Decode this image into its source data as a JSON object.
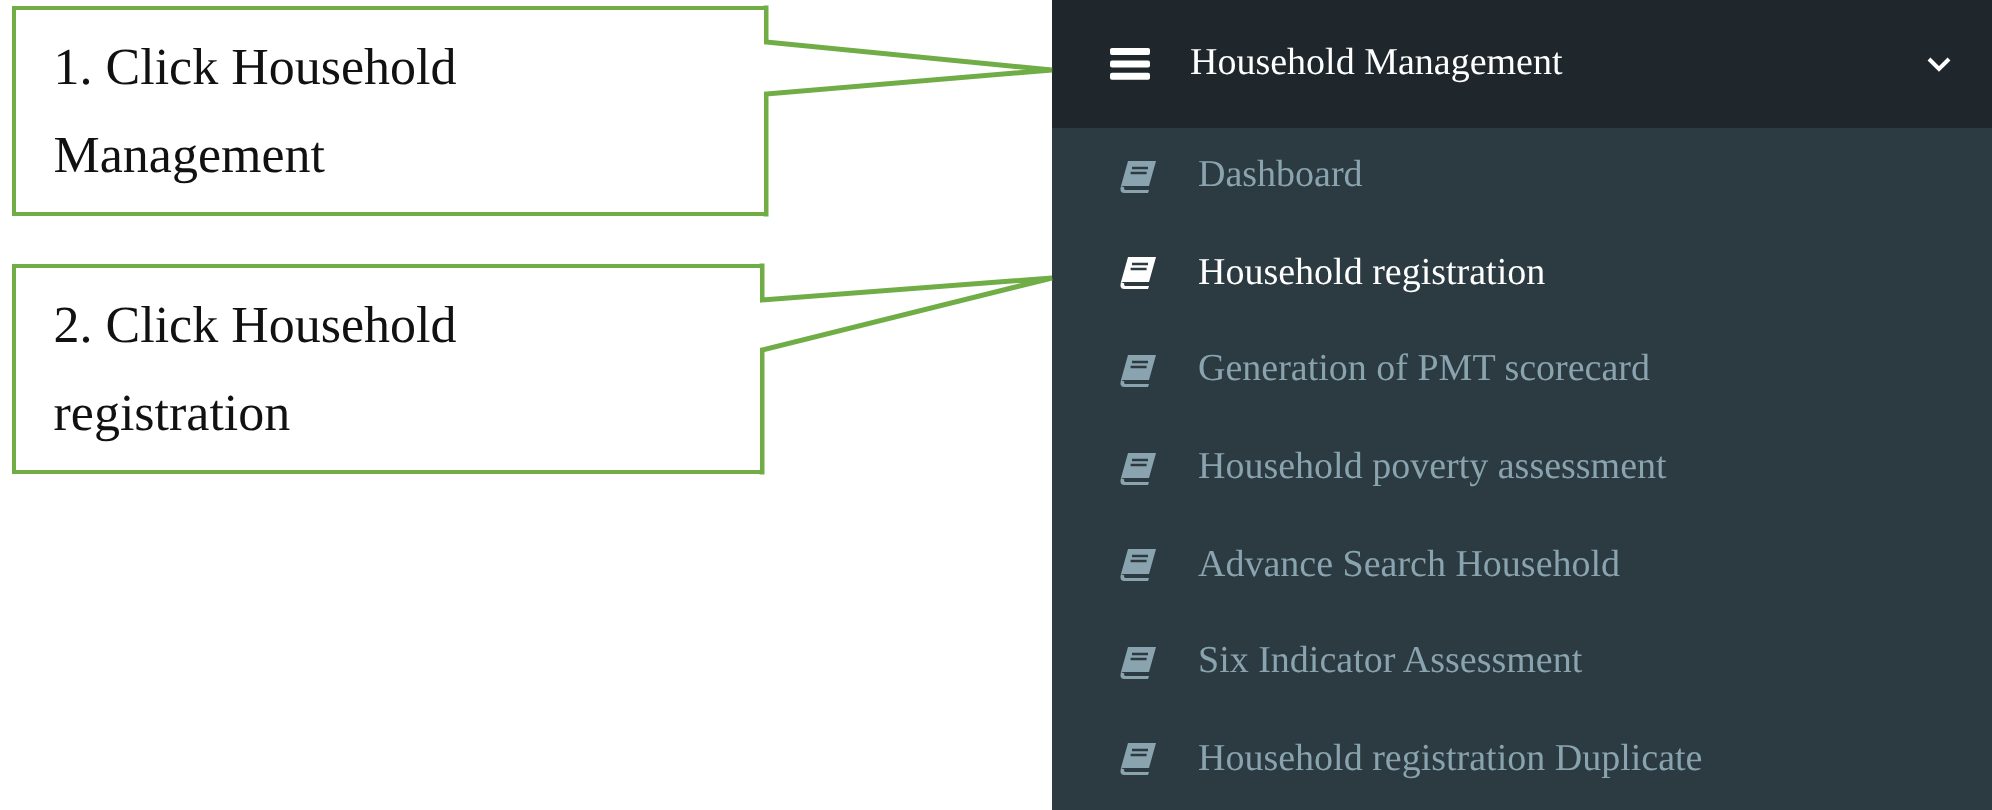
{
  "callouts": [
    {
      "text": "1. Click Household Management"
    },
    {
      "text": "2. Click Household registration"
    }
  ],
  "menu": {
    "title": "Household Management",
    "expanded": true,
    "items": [
      {
        "label": "Dashboard",
        "selected": false
      },
      {
        "label": "Household registration",
        "selected": true
      },
      {
        "label": "Generation of PMT scorecard",
        "selected": false
      },
      {
        "label": "Household poverty assessment",
        "selected": false
      },
      {
        "label": "Advance Search Household",
        "selected": false
      },
      {
        "label": "Six Indicator Assessment",
        "selected": false
      },
      {
        "label": "Household registration Duplicate",
        "selected": false
      }
    ]
  }
}
